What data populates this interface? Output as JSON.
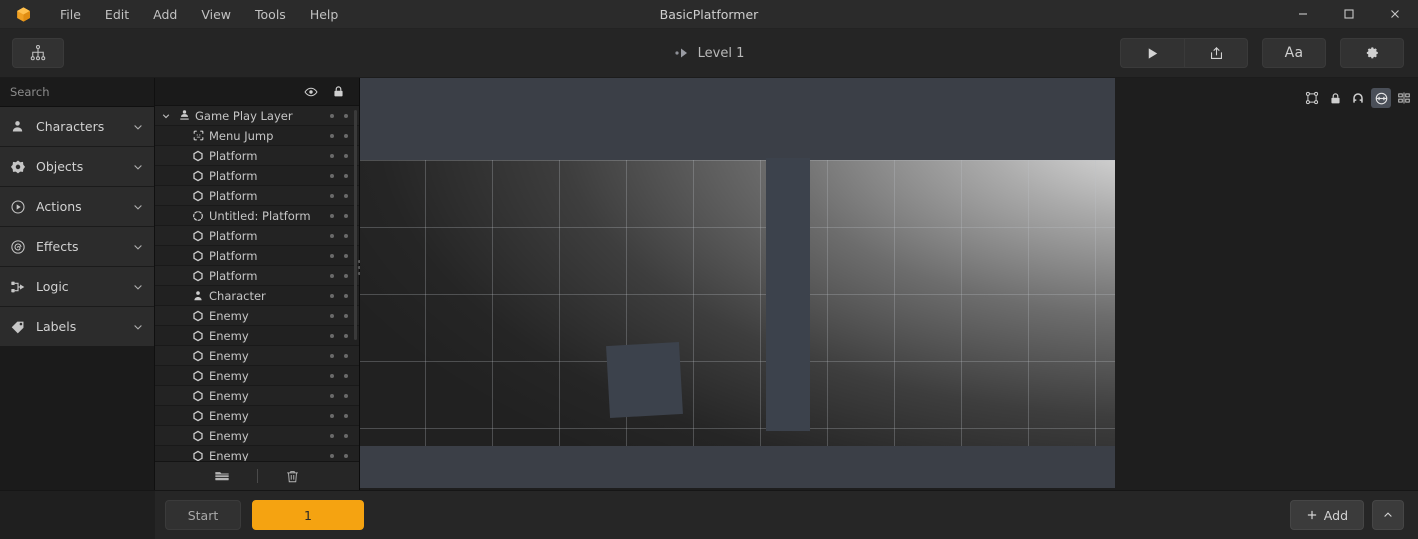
{
  "window": {
    "title": "BasicPlatformer",
    "logo_icon": "box-logo-icon",
    "minimize_icon": "minimize-icon",
    "maximize_icon": "maximize-icon",
    "close_icon": "close-icon",
    "accent_color": "#f5a311",
    "titlebar_color": "#2b2b2b"
  },
  "menubar": {
    "items": [
      {
        "label": "File"
      },
      {
        "label": "Edit"
      },
      {
        "label": "Add"
      },
      {
        "label": "View"
      },
      {
        "label": "Tools"
      },
      {
        "label": "Help"
      }
    ]
  },
  "toolbar": {
    "hierarchy_button": {
      "icon": "hierarchy-icon",
      "label": ""
    },
    "level": {
      "label": "Level 1",
      "icon": "play-dot-icon"
    },
    "play_button": {
      "icon": "play-icon"
    },
    "export_button": {
      "icon": "export-icon"
    },
    "text_button": {
      "label": "Aa"
    },
    "settings_button": {
      "icon": "gear-icon"
    }
  },
  "sidebar": {
    "search": {
      "placeholder": "Search",
      "value": "",
      "icon": "search-icon"
    },
    "items": [
      {
        "label": "Characters",
        "icon": "person-icon",
        "chevron": "chevron-down-icon"
      },
      {
        "label": "Objects",
        "icon": "objects-icon",
        "chevron": "chevron-down-icon"
      },
      {
        "label": "Actions",
        "icon": "play-circle-icon",
        "chevron": "chevron-down-icon"
      },
      {
        "label": "Effects",
        "icon": "spiral-icon",
        "chevron": "chevron-down-icon"
      },
      {
        "label": "Logic",
        "icon": "logic-node-icon",
        "chevron": "chevron-down-icon"
      },
      {
        "label": "Labels",
        "icon": "tag-icon",
        "chevron": "chevron-down-icon"
      }
    ]
  },
  "layers_panel": {
    "header": {
      "visibility_icon": "eye-icon",
      "lock_icon": "lock-icon"
    },
    "rows": [
      {
        "label": "Game Play Layer",
        "icon": "layer-person-icon",
        "indent": 0,
        "expanded": true,
        "chevron": "chevron-down-icon"
      },
      {
        "label": "Menu Jump",
        "icon": "dashed-square-icon",
        "indent": 1
      },
      {
        "label": "Platform",
        "icon": "hexagon-icon",
        "indent": 1
      },
      {
        "label": "Platform",
        "icon": "hexagon-icon",
        "indent": 1
      },
      {
        "label": "Platform",
        "icon": "hexagon-icon",
        "indent": 1
      },
      {
        "label": "Untitled: Platform",
        "icon": "dashed-circle-icon",
        "indent": 1
      },
      {
        "label": "Platform",
        "icon": "hexagon-icon",
        "indent": 1
      },
      {
        "label": "Platform",
        "icon": "hexagon-icon",
        "indent": 1
      },
      {
        "label": "Platform",
        "icon": "hexagon-icon",
        "indent": 1
      },
      {
        "label": "Character",
        "icon": "person-solid-icon",
        "indent": 1
      },
      {
        "label": "Enemy",
        "icon": "hexagon-icon",
        "indent": 1
      },
      {
        "label": "Enemy",
        "icon": "hexagon-icon",
        "indent": 1
      },
      {
        "label": "Enemy",
        "icon": "hexagon-icon",
        "indent": 1
      },
      {
        "label": "Enemy",
        "icon": "hexagon-icon",
        "indent": 1
      },
      {
        "label": "Enemy",
        "icon": "hexagon-icon",
        "indent": 1
      },
      {
        "label": "Enemy",
        "icon": "hexagon-icon",
        "indent": 1
      },
      {
        "label": "Enemy",
        "icon": "hexagon-icon",
        "indent": 1
      },
      {
        "label": "Enemy",
        "icon": "hexagon-icon",
        "indent": 1
      }
    ],
    "footer": {
      "new_folder_icon": "folder-icon",
      "delete_icon": "trash-icon"
    }
  },
  "canvas": {
    "tools": [
      {
        "icon": "transform-handles-icon",
        "active": false
      },
      {
        "icon": "lock-icon",
        "active": false
      },
      {
        "icon": "magnet-icon",
        "active": false
      },
      {
        "icon": "link-icon",
        "active": true
      },
      {
        "icon": "align-icon",
        "active": false
      }
    ],
    "objects": [
      {
        "name": "pillar-platform"
      },
      {
        "name": "box-platform"
      }
    ]
  },
  "bottombar": {
    "start_button": {
      "label": "Start"
    },
    "scene_button": {
      "label": "1",
      "selected": true
    },
    "add_button": {
      "label": "Add",
      "icon": "plus-icon"
    },
    "collapse_button": {
      "icon": "chevron-up-icon"
    }
  }
}
